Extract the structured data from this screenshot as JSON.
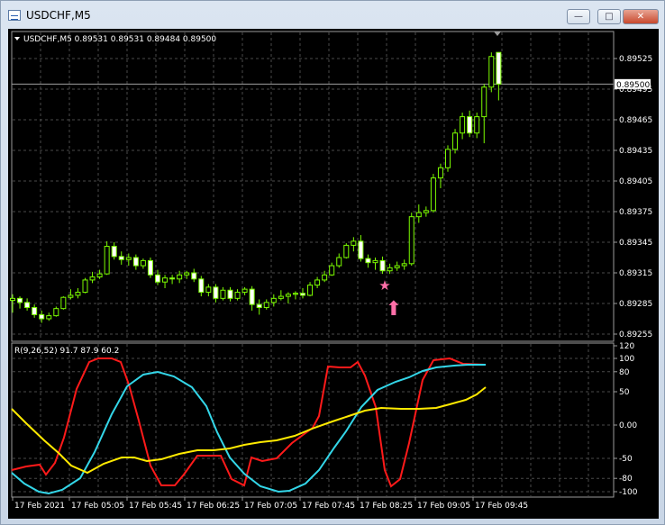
{
  "window": {
    "title": "USDCHF,M5",
    "minimize_glyph": "—",
    "maximize_glyph": "□",
    "close_glyph": "✕"
  },
  "main_chart": {
    "header": "USDCHF,M5  0.89531 0.89531 0.89484 0.89500",
    "price_ticks": [
      "0.89525",
      "0.89495",
      "0.89465",
      "0.89435",
      "0.89405",
      "0.89375",
      "0.89345",
      "0.89315",
      "0.89285",
      "0.89255"
    ],
    "current_price_label": "0.89500",
    "colors": {
      "background": "#000000",
      "grid": "#4a4a4a",
      "candle": "#7cfc00",
      "bull_body": "#000000",
      "bear_body": "#ffffff",
      "text": "#ffffff"
    },
    "candles_ohlc": [
      [
        0.89288,
        0.89294,
        0.89276,
        0.8929
      ],
      [
        0.8929,
        0.89292,
        0.8928,
        0.89286
      ],
      [
        0.89286,
        0.8929,
        0.89278,
        0.89281
      ],
      [
        0.89281,
        0.89284,
        0.89271,
        0.89274
      ],
      [
        0.89274,
        0.89278,
        0.89266,
        0.8927
      ],
      [
        0.8927,
        0.89276,
        0.89268,
        0.89273
      ],
      [
        0.89273,
        0.89282,
        0.89272,
        0.8928
      ],
      [
        0.8928,
        0.89292,
        0.89279,
        0.89291
      ],
      [
        0.89291,
        0.89299,
        0.89289,
        0.89293
      ],
      [
        0.89293,
        0.893,
        0.8929,
        0.89296
      ],
      [
        0.89296,
        0.8931,
        0.89295,
        0.89308
      ],
      [
        0.89308,
        0.89316,
        0.89305,
        0.89311
      ],
      [
        0.89311,
        0.89318,
        0.89309,
        0.89314
      ],
      [
        0.89314,
        0.89346,
        0.89313,
        0.89341
      ],
      [
        0.89341,
        0.89345,
        0.89328,
        0.89331
      ],
      [
        0.89331,
        0.89336,
        0.89323,
        0.89328
      ],
      [
        0.89328,
        0.89334,
        0.89322,
        0.8933
      ],
      [
        0.8933,
        0.89333,
        0.89318,
        0.89322
      ],
      [
        0.89322,
        0.89329,
        0.89319,
        0.89327
      ],
      [
        0.89327,
        0.8933,
        0.8931,
        0.89313
      ],
      [
        0.89313,
        0.89318,
        0.89303,
        0.89306
      ],
      [
        0.89306,
        0.89313,
        0.893,
        0.8931
      ],
      [
        0.8931,
        0.89313,
        0.89304,
        0.89309
      ],
      [
        0.89309,
        0.89317,
        0.89305,
        0.89313
      ],
      [
        0.89313,
        0.89317,
        0.89309,
        0.89315
      ],
      [
        0.89315,
        0.89319,
        0.89306,
        0.89309
      ],
      [
        0.89309,
        0.89312,
        0.89292,
        0.89296
      ],
      [
        0.89296,
        0.89304,
        0.89292,
        0.89301
      ],
      [
        0.89301,
        0.89304,
        0.89286,
        0.8929
      ],
      [
        0.8929,
        0.89301,
        0.89288,
        0.89298
      ],
      [
        0.89298,
        0.89301,
        0.89287,
        0.8929
      ],
      [
        0.8929,
        0.89299,
        0.89288,
        0.89296
      ],
      [
        0.89296,
        0.89301,
        0.89293,
        0.89299
      ],
      [
        0.89299,
        0.89302,
        0.89278,
        0.89284
      ],
      [
        0.89284,
        0.89289,
        0.89274,
        0.89281
      ],
      [
        0.89281,
        0.89289,
        0.89279,
        0.89286
      ],
      [
        0.89286,
        0.89294,
        0.89282,
        0.8929
      ],
      [
        0.8929,
        0.89298,
        0.89288,
        0.89292
      ],
      [
        0.89292,
        0.89296,
        0.89285,
        0.89294
      ],
      [
        0.89294,
        0.89297,
        0.89289,
        0.89295
      ],
      [
        0.89295,
        0.893,
        0.8929,
        0.89293
      ],
      [
        0.89293,
        0.89306,
        0.89292,
        0.89303
      ],
      [
        0.89303,
        0.89311,
        0.893,
        0.89308
      ],
      [
        0.89308,
        0.89317,
        0.89306,
        0.89313
      ],
      [
        0.89313,
        0.89325,
        0.89312,
        0.89322
      ],
      [
        0.89322,
        0.89334,
        0.8932,
        0.8933
      ],
      [
        0.8933,
        0.89344,
        0.89329,
        0.89342
      ],
      [
        0.89342,
        0.8935,
        0.89336,
        0.89346
      ],
      [
        0.89346,
        0.89352,
        0.89326,
        0.89329
      ],
      [
        0.89329,
        0.89333,
        0.8932,
        0.89325
      ],
      [
        0.89325,
        0.8933,
        0.89318,
        0.89327
      ],
      [
        0.89327,
        0.89331,
        0.89314,
        0.89317
      ],
      [
        0.89317,
        0.89324,
        0.89314,
        0.8932
      ],
      [
        0.8932,
        0.89326,
        0.89317,
        0.89322
      ],
      [
        0.89322,
        0.89328,
        0.89318,
        0.89324
      ],
      [
        0.89324,
        0.89374,
        0.89322,
        0.8937
      ],
      [
        0.8937,
        0.89382,
        0.89364,
        0.89374
      ],
      [
        0.89374,
        0.8938,
        0.8937,
        0.89376
      ],
      [
        0.89376,
        0.89412,
        0.89374,
        0.89408
      ],
      [
        0.89408,
        0.89422,
        0.89398,
        0.89418
      ],
      [
        0.89418,
        0.8944,
        0.89414,
        0.89436
      ],
      [
        0.89436,
        0.89456,
        0.89432,
        0.89452
      ],
      [
        0.89452,
        0.89472,
        0.89446,
        0.89468
      ],
      [
        0.89468,
        0.89474,
        0.89448,
        0.89452
      ],
      [
        0.89452,
        0.89472,
        0.89447,
        0.89468
      ],
      [
        0.89468,
        0.895,
        0.89442,
        0.89497
      ],
      [
        0.89497,
        0.89531,
        0.89492,
        0.89527
      ],
      [
        0.89531,
        0.89531,
        0.89484,
        0.895
      ]
    ]
  },
  "markers": {
    "star_glyph": "★",
    "arrow_glyph": "⬆",
    "color": "#ff6fa8"
  },
  "indicator": {
    "header": "R(9,26,52) 91.7 87.9 60.2",
    "ticks": [
      "120",
      "100",
      "80",
      "50",
      "0.00",
      "-50",
      "-80",
      "-100"
    ],
    "colors": {
      "red": "#ff1a1a",
      "cyan": "#33d6e8",
      "yellow": "#ffea00"
    }
  },
  "time_labels": [
    "17 Feb 2021",
    "17 Feb 05:05",
    "17 Feb 05:45",
    "17 Feb 06:25",
    "17 Feb 07:05",
    "17 Feb 07:45",
    "17 Feb 08:25",
    "17 Feb 09:05",
    "17 Feb 09:45"
  ]
}
